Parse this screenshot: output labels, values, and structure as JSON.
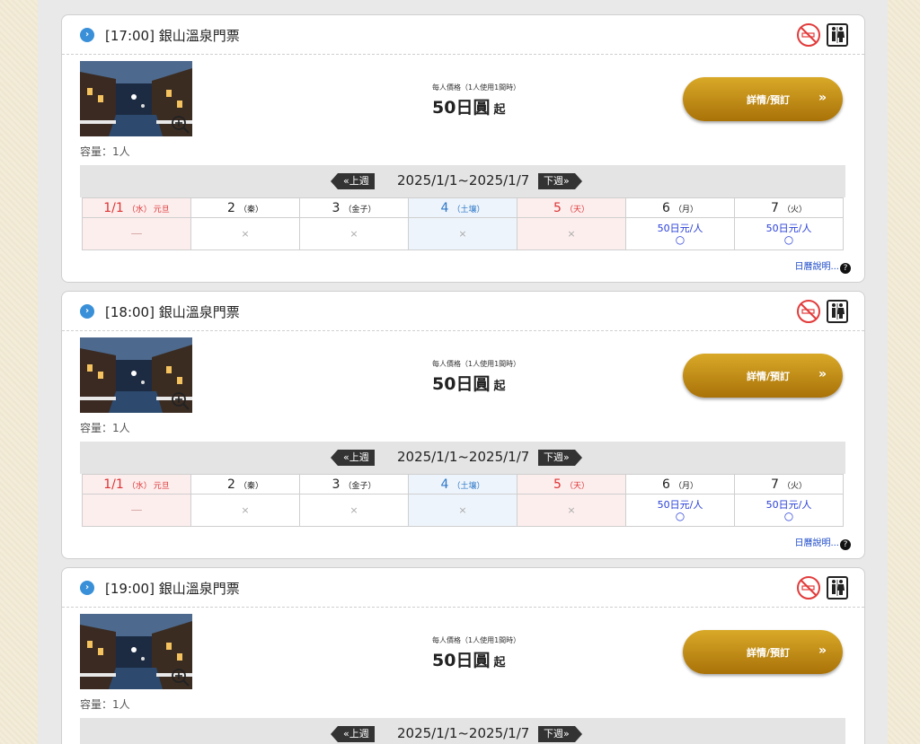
{
  "cards": [
    {
      "title": "[17:00] 銀山溫泉門票",
      "capacity": "容量：1人",
      "price_note": "每人價格（1人使用1間時）",
      "price": "50日圓",
      "price_suffix": "起",
      "book_label": "詳情/預訂",
      "book_arrow": "»",
      "week": {
        "prev": "«上週",
        "range": "2025/1/1~2025/1/7",
        "next": "下週»"
      },
      "legend": "日曆說明...",
      "days": [
        {
          "num": "1/1",
          "weekday": "（水）",
          "holiday": "元旦",
          "status": "—"
        },
        {
          "num": "2",
          "weekday": "（秦）",
          "status": "×"
        },
        {
          "num": "3",
          "weekday": "（金子）",
          "status": "×"
        },
        {
          "num": "4",
          "weekday": "（土壤）",
          "status": "×"
        },
        {
          "num": "5",
          "weekday": "（天）",
          "status": "×"
        },
        {
          "num": "6",
          "weekday": "（月）",
          "price": "50日元/人",
          "mark": "○"
        },
        {
          "num": "7",
          "weekday": "（火）",
          "price": "50日元/人",
          "mark": "○"
        }
      ]
    },
    {
      "title": "[18:00] 銀山溫泉門票",
      "capacity": "容量：1人",
      "price_note": "每人價格（1人使用1間時）",
      "price": "50日圓",
      "price_suffix": "起",
      "book_label": "詳情/預訂",
      "book_arrow": "»",
      "week": {
        "prev": "«上週",
        "range": "2025/1/1~2025/1/7",
        "next": "下週»"
      },
      "legend": "日曆說明...",
      "days": [
        {
          "num": "1/1",
          "weekday": "（水）",
          "holiday": "元旦",
          "status": "—"
        },
        {
          "num": "2",
          "weekday": "（秦）",
          "status": "×"
        },
        {
          "num": "3",
          "weekday": "（金子）",
          "status": "×"
        },
        {
          "num": "4",
          "weekday": "（土壤）",
          "status": "×"
        },
        {
          "num": "5",
          "weekday": "（天）",
          "status": "×"
        },
        {
          "num": "6",
          "weekday": "（月）",
          "price": "50日元/人",
          "mark": "○"
        },
        {
          "num": "7",
          "weekday": "（火）",
          "price": "50日元/人",
          "mark": "○"
        }
      ]
    },
    {
      "title": "[19:00] 銀山溫泉門票",
      "capacity": "容量：1人",
      "price_note": "每人價格（1人使用1間時）",
      "price": "50日圓",
      "price_suffix": "起",
      "book_label": "詳情/預訂",
      "book_arrow": "»",
      "week": {
        "prev": "«上週",
        "range": "2025/1/1~2025/1/7",
        "next": "下週»"
      },
      "legend": "",
      "days": []
    }
  ],
  "icons": {
    "bullet": "chevron-right-circle-icon",
    "no_smoking": "no-smoking-icon",
    "restroom": "restroom-icon",
    "zoom": "zoom-in-icon",
    "help": "question-circle-icon"
  },
  "colors": {
    "gold_button": "#c58f17",
    "holiday_red": "#d33333",
    "saturday_blue": "#2d78c8",
    "available_blue": "#2a40d8",
    "no_smoking_red": "#e23b3b"
  }
}
